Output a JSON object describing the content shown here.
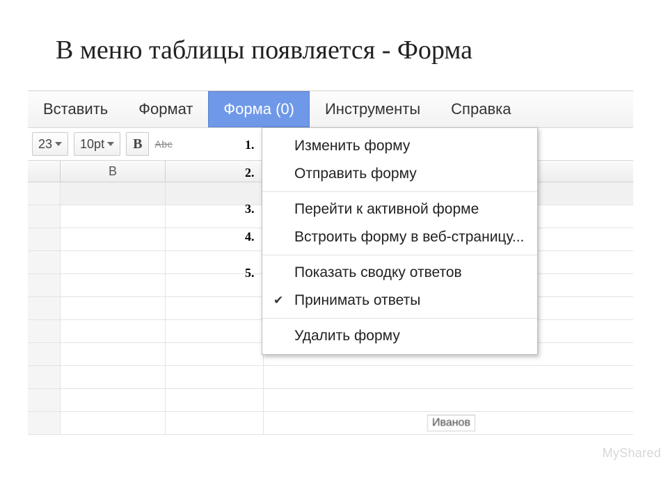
{
  "slide_title": "В меню таблицы появляется - Форма",
  "menubar": {
    "items": [
      "Вставить",
      "Формат",
      "Форма (0)",
      "Инструменты",
      "Справка"
    ],
    "active_index": 2
  },
  "toolbar": {
    "format_button": "23",
    "fontsize_button": "10pt",
    "bold_glyph": "B",
    "strike_glyph": "Abc"
  },
  "grid": {
    "column_b_label": "B"
  },
  "dropdown": {
    "groups": [
      [
        "Изменить форму",
        "Отправить форму"
      ],
      [
        "Перейти к активной форме",
        "Встроить форму в веб-страницу..."
      ],
      [
        "Показать сводку ответов",
        "Принимать ответы"
      ],
      [
        "Удалить форму"
      ]
    ],
    "checked_label": "Принимать ответы"
  },
  "annotations": [
    "1.",
    "2.",
    "3.",
    "4.",
    "5."
  ],
  "watermark": "MyShared",
  "bottom_snippet": "Иванов"
}
